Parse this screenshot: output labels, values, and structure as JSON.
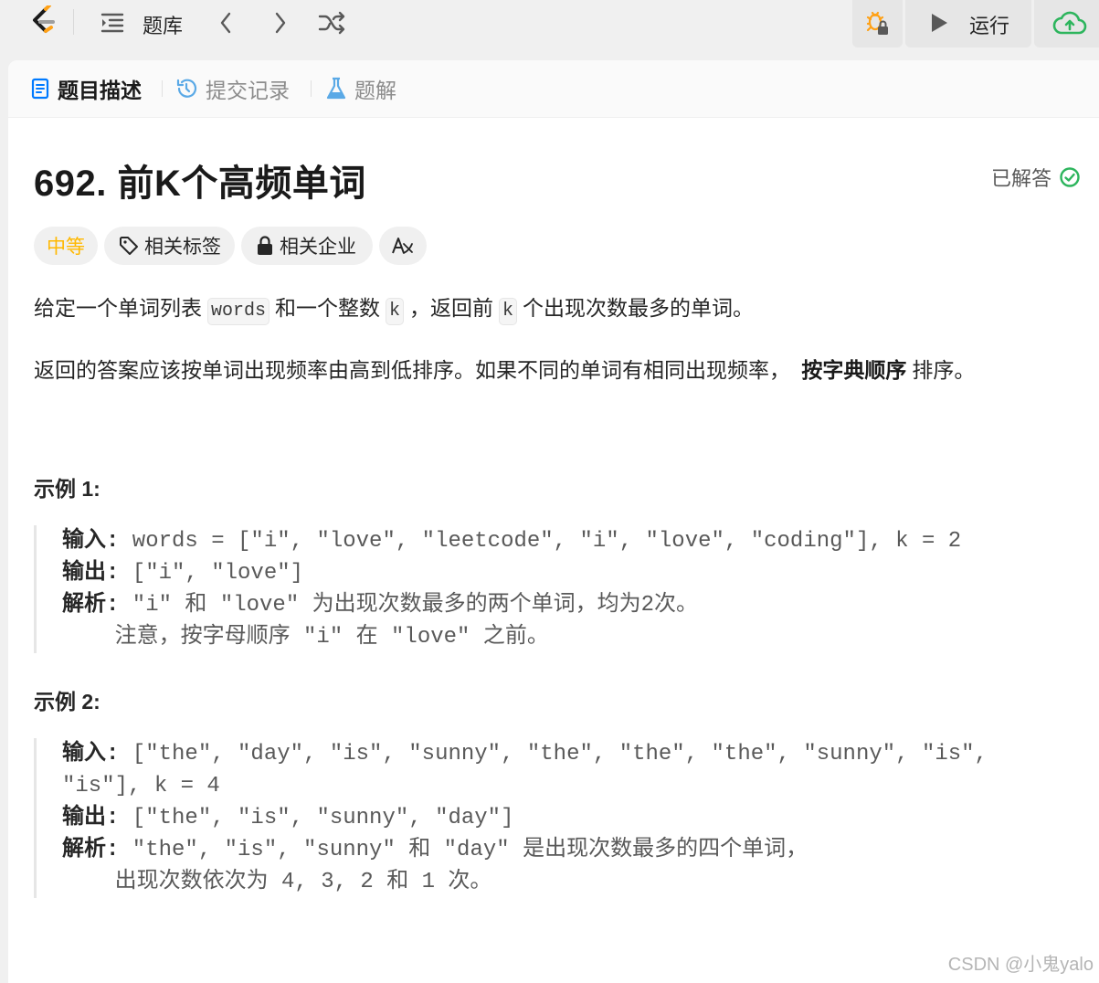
{
  "topbar": {
    "problem_list_label": "题库",
    "run_label": "运行"
  },
  "tabs": [
    {
      "label": "题目描述",
      "icon": "description-icon",
      "active": true
    },
    {
      "label": "提交记录",
      "icon": "history-icon",
      "active": false
    },
    {
      "label": "题解",
      "icon": "flask-icon",
      "active": false
    }
  ],
  "problem": {
    "title": "692. 前K个高频单词",
    "status": "已解答",
    "difficulty": "中等",
    "tags_label": "相关标签",
    "companies_label": "相关企业",
    "desc1_a": "给定一个单词列表",
    "desc1_code1": "words",
    "desc1_b": "和一个整数",
    "desc1_code2": "k",
    "desc1_c": "，返回前",
    "desc1_code3": "k",
    "desc1_d": "个出现次数最多的单词。",
    "desc2_a": "返回的答案应该按单词出现频率由高到低排序。如果不同的单词有相同出现频率，",
    "desc2_bold": "按字典顺序",
    "desc2_b": "排序。"
  },
  "examples": [
    {
      "heading": "示例 1:",
      "lines": [
        {
          "label": "输入:",
          "text": " words = [\"i\", \"love\", \"leetcode\", \"i\", \"love\", \"coding\"], k = 2"
        },
        {
          "label": "输出:",
          "text": " [\"i\", \"love\"]"
        },
        {
          "label": "解析:",
          "text": " \"i\" 和 \"love\" 为出现次数最多的两个单词，均为2次。"
        },
        {
          "label": "",
          "text": "    注意，按字母顺序 \"i\" 在 \"love\" 之前。"
        }
      ]
    },
    {
      "heading": "示例 2:",
      "lines": [
        {
          "label": "输入:",
          "text": " [\"the\", \"day\", \"is\", \"sunny\", \"the\", \"the\", \"the\", \"sunny\", \"is\","
        },
        {
          "label": "",
          "text": "\"is\"], k = 4"
        },
        {
          "label": "输出:",
          "text": " [\"the\", \"is\", \"sunny\", \"day\"]"
        },
        {
          "label": "解析:",
          "text": " \"the\", \"is\", \"sunny\" 和 \"day\" 是出现次数最多的四个单词，"
        },
        {
          "label": "",
          "text": "    出现次数依次为 4, 3, 2 和 1 次。"
        }
      ]
    }
  ],
  "watermark": "CSDN @小鬼yalo",
  "colors": {
    "difficulty": "#ffb800",
    "solved_check": "#2db55d",
    "cloud": "#2db55d",
    "tab_blue": "#007aff"
  }
}
